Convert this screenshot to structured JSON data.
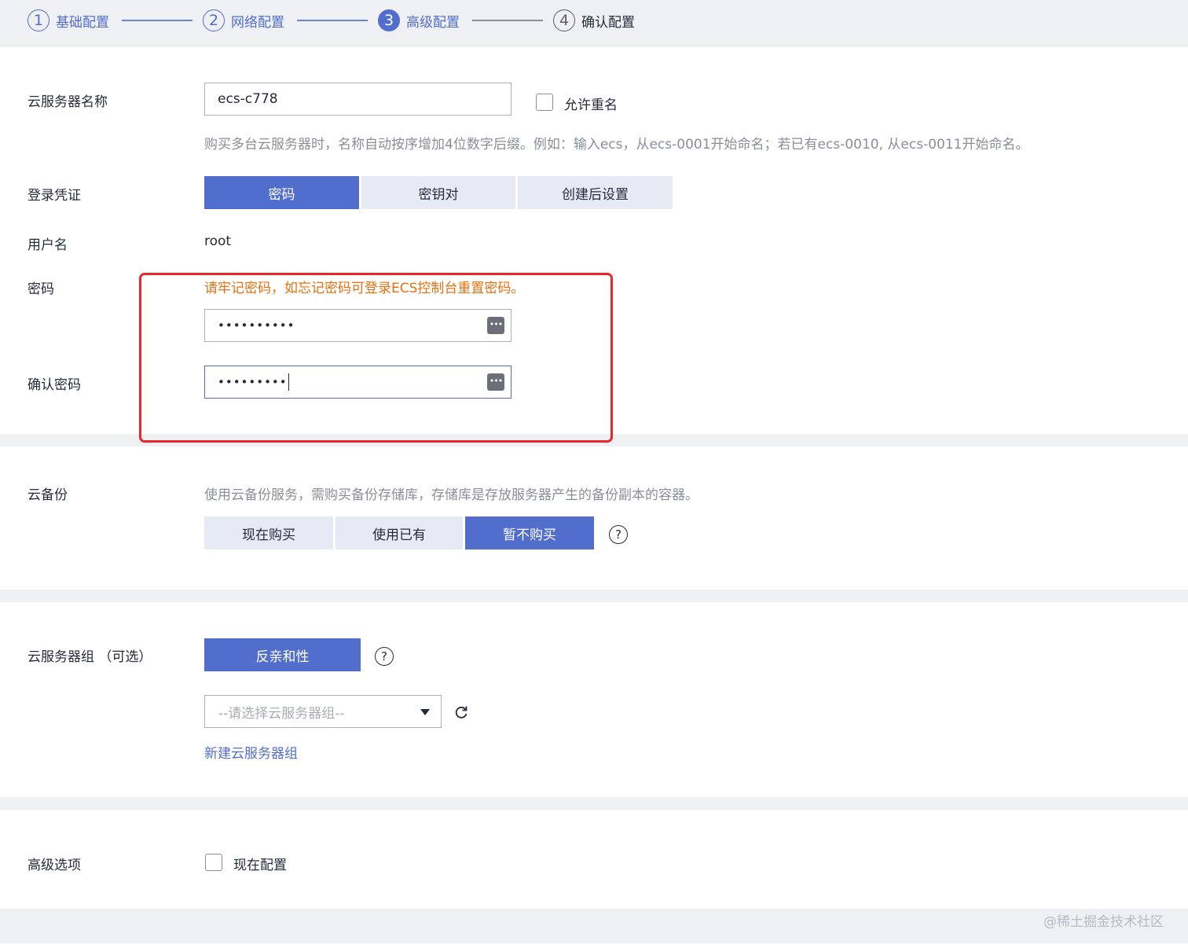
{
  "stepper": {
    "steps": [
      {
        "num": "1",
        "label": "基础配置"
      },
      {
        "num": "2",
        "label": "网络配置"
      },
      {
        "num": "3",
        "label": "高级配置"
      },
      {
        "num": "4",
        "label": "确认配置"
      }
    ]
  },
  "server_name": {
    "label": "云服务器名称",
    "value": "ecs-c778",
    "allow_duplicate_label": "允许重名",
    "allow_duplicate_checked": false,
    "hint": "购买多台云服务器时，名称自动按序增加4位数字后缀。例如：输入ecs，从ecs-0001开始命名；若已有ecs-0010, 从ecs-0011开始命名。"
  },
  "login_credential": {
    "label": "登录凭证",
    "options": [
      "密码",
      "密钥对",
      "创建后设置"
    ],
    "selected": "密码"
  },
  "username": {
    "label": "用户名",
    "value": "root"
  },
  "password": {
    "label": "密码",
    "warning": "请牢记密码，如忘记密码可登录ECS控制台重置密码。",
    "value": "••••••••••",
    "toggle_icon": "password-reveal-icon"
  },
  "confirm_password": {
    "label": "确认密码",
    "value": "•••••••••",
    "toggle_icon": "password-reveal-icon"
  },
  "cloud_backup": {
    "label": "云备份",
    "hint": "使用云备份服务，需购买备份存储库，存储库是存放服务器产生的备份副本的容器。",
    "options": [
      "现在购买",
      "使用已有",
      "暂不购买"
    ],
    "selected": "暂不购买",
    "help_icon": "?"
  },
  "server_group": {
    "label": "云服务器组 （可选）",
    "button_label": "反亲和性",
    "help_icon": "?",
    "select_placeholder": "--请选择云服务器组--",
    "create_link": "新建云服务器组"
  },
  "advanced_options": {
    "label": "高级选项",
    "checkbox_label": "现在配置",
    "checked": false
  },
  "watermark": "@稀土掘金技术社区",
  "colors": {
    "accent": "#526ecc",
    "warning_text": "#e6700f",
    "highlight_border": "#e8272c"
  }
}
